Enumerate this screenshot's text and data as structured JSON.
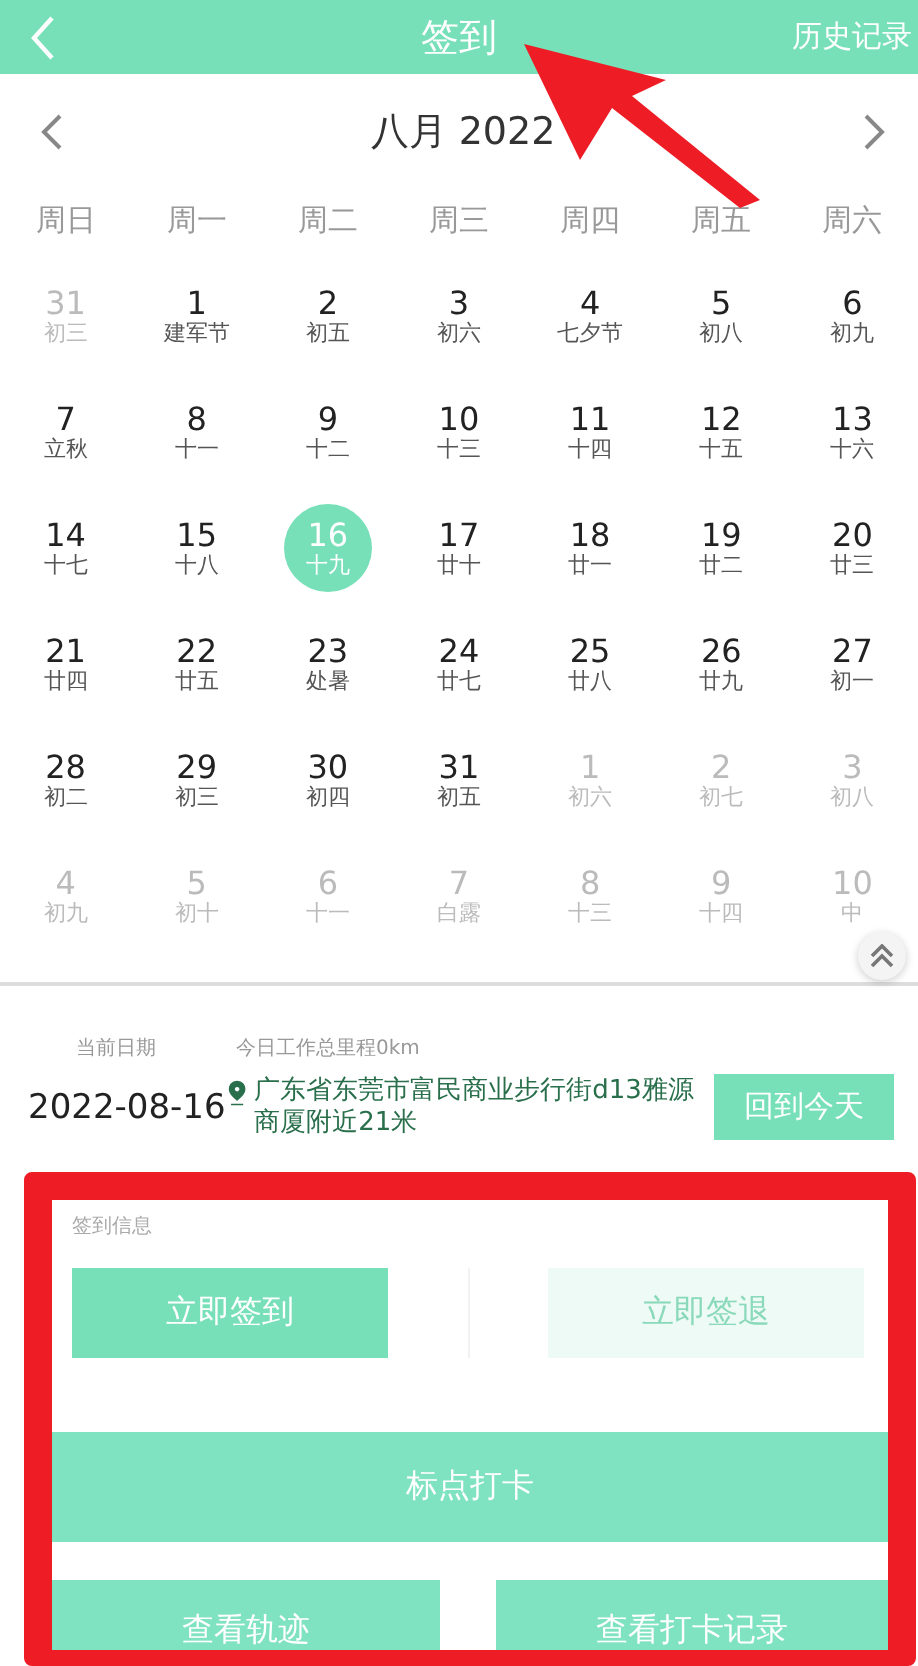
{
  "header": {
    "title": "签到",
    "action": "历史记录"
  },
  "calendar": {
    "month": "八月 2022",
    "weekdays": [
      "周日",
      "周一",
      "周二",
      "周三",
      "周四",
      "周五",
      "周六"
    ],
    "days": [
      {
        "day": "31",
        "lunar": "初三",
        "muted": true,
        "selected": false
      },
      {
        "day": "1",
        "lunar": "建军节",
        "muted": false,
        "selected": false
      },
      {
        "day": "2",
        "lunar": "初五",
        "muted": false,
        "selected": false
      },
      {
        "day": "3",
        "lunar": "初六",
        "muted": false,
        "selected": false
      },
      {
        "day": "4",
        "lunar": "七夕节",
        "muted": false,
        "selected": false
      },
      {
        "day": "5",
        "lunar": "初八",
        "muted": false,
        "selected": false
      },
      {
        "day": "6",
        "lunar": "初九",
        "muted": false,
        "selected": false
      },
      {
        "day": "7",
        "lunar": "立秋",
        "muted": false,
        "selected": false
      },
      {
        "day": "8",
        "lunar": "十一",
        "muted": false,
        "selected": false
      },
      {
        "day": "9",
        "lunar": "十二",
        "muted": false,
        "selected": false
      },
      {
        "day": "10",
        "lunar": "十三",
        "muted": false,
        "selected": false
      },
      {
        "day": "11",
        "lunar": "十四",
        "muted": false,
        "selected": false
      },
      {
        "day": "12",
        "lunar": "十五",
        "muted": false,
        "selected": false
      },
      {
        "day": "13",
        "lunar": "十六",
        "muted": false,
        "selected": false
      },
      {
        "day": "14",
        "lunar": "十七",
        "muted": false,
        "selected": false
      },
      {
        "day": "15",
        "lunar": "十八",
        "muted": false,
        "selected": false
      },
      {
        "day": "16",
        "lunar": "十九",
        "muted": false,
        "selected": true
      },
      {
        "day": "17",
        "lunar": "廿十",
        "muted": false,
        "selected": false
      },
      {
        "day": "18",
        "lunar": "廿一",
        "muted": false,
        "selected": false
      },
      {
        "day": "19",
        "lunar": "廿二",
        "muted": false,
        "selected": false
      },
      {
        "day": "20",
        "lunar": "廿三",
        "muted": false,
        "selected": false
      },
      {
        "day": "21",
        "lunar": "廿四",
        "muted": false,
        "selected": false
      },
      {
        "day": "22",
        "lunar": "廿五",
        "muted": false,
        "selected": false
      },
      {
        "day": "23",
        "lunar": "处暑",
        "muted": false,
        "selected": false
      },
      {
        "day": "24",
        "lunar": "廿七",
        "muted": false,
        "selected": false
      },
      {
        "day": "25",
        "lunar": "廿八",
        "muted": false,
        "selected": false
      },
      {
        "day": "26",
        "lunar": "廿九",
        "muted": false,
        "selected": false
      },
      {
        "day": "27",
        "lunar": "初一",
        "muted": false,
        "selected": false
      },
      {
        "day": "28",
        "lunar": "初二",
        "muted": false,
        "selected": false
      },
      {
        "day": "29",
        "lunar": "初三",
        "muted": false,
        "selected": false
      },
      {
        "day": "30",
        "lunar": "初四",
        "muted": false,
        "selected": false
      },
      {
        "day": "31",
        "lunar": "初五",
        "muted": false,
        "selected": false
      },
      {
        "day": "1",
        "lunar": "初六",
        "muted": true,
        "selected": false
      },
      {
        "day": "2",
        "lunar": "初七",
        "muted": true,
        "selected": false
      },
      {
        "day": "3",
        "lunar": "初八",
        "muted": true,
        "selected": false
      },
      {
        "day": "4",
        "lunar": "初九",
        "muted": true,
        "selected": false
      },
      {
        "day": "5",
        "lunar": "初十",
        "muted": true,
        "selected": false
      },
      {
        "day": "6",
        "lunar": "十一",
        "muted": true,
        "selected": false
      },
      {
        "day": "7",
        "lunar": "白露",
        "muted": true,
        "selected": false
      },
      {
        "day": "8",
        "lunar": "十三",
        "muted": true,
        "selected": false
      },
      {
        "day": "9",
        "lunar": "十四",
        "muted": true,
        "selected": false
      },
      {
        "day": "10",
        "lunar": "中",
        "muted": true,
        "selected": false
      }
    ]
  },
  "info": {
    "date_label": "当前日期",
    "mileage": "今日工作总里程0km",
    "date": "2022-08-16",
    "location": "广东省东莞市富民商业步行街d13雅源商厦附近21米",
    "today_button": "回到今天"
  },
  "signin": {
    "label": "签到信息",
    "actions": [
      {
        "label": "立即签到",
        "disabled": false
      },
      {
        "label": "立即签退",
        "disabled": true
      }
    ],
    "mark_button": "标点打卡",
    "bottom_buttons": [
      "查看轨迹",
      "查看打卡记录"
    ]
  },
  "annotations": {
    "arrow": true,
    "highlight_frame": true
  }
}
